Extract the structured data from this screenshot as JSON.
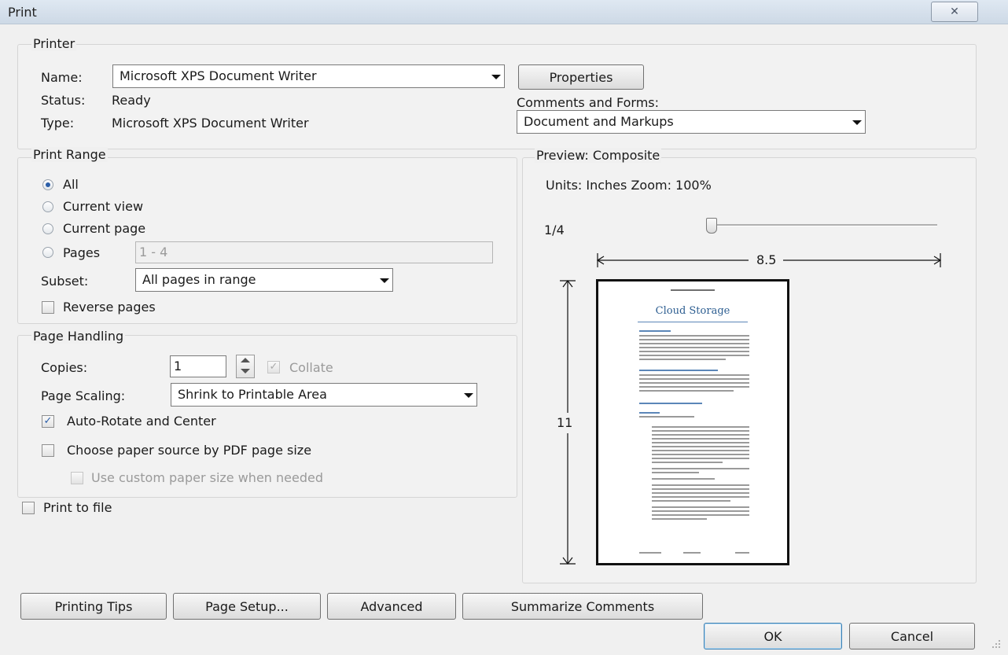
{
  "window": {
    "title": "Print",
    "close_glyph": "✕"
  },
  "printer": {
    "group_title": "Printer",
    "name_label": "Name:",
    "name_value": "Microsoft XPS Document Writer",
    "properties_label": "Properties",
    "status_label": "Status:",
    "status_value": "Ready",
    "type_label": "Type:",
    "type_value": "Microsoft XPS Document Writer",
    "comments_label": "Comments and Forms:",
    "comments_value": "Document and Markups"
  },
  "print_range": {
    "group_title": "Print Range",
    "options": [
      "All",
      "Current view",
      "Current page",
      "Pages"
    ],
    "selected": "All",
    "pages_value": "1 - 4",
    "subset_label": "Subset:",
    "subset_value": "All pages in range",
    "reverse_label": "Reverse pages",
    "reverse_checked": false
  },
  "page_handling": {
    "group_title": "Page Handling",
    "copies_label": "Copies:",
    "copies_value": "1",
    "collate_label": "Collate",
    "collate_checked": true,
    "scaling_label": "Page Scaling:",
    "scaling_value": "Shrink to Printable Area",
    "autorotate_label": "Auto-Rotate and Center",
    "autorotate_checked": true,
    "paper_source_label": "Choose paper source by PDF page size",
    "paper_source_checked": false,
    "custom_paper_label": "Use custom paper size when needed",
    "custom_paper_checked": false
  },
  "print_to_file": {
    "label": "Print to file",
    "checked": false
  },
  "preview": {
    "group_title": "Preview: Composite",
    "units_zoom": "Units: Inches Zoom: 100%",
    "page_indicator": "1/4",
    "width_label": "8.5",
    "height_label": "11",
    "doc_title": "Cloud Storage"
  },
  "buttons": {
    "printing_tips": "Printing Tips",
    "page_setup": "Page Setup...",
    "advanced": "Advanced",
    "summarize": "Summarize Comments",
    "ok": "OK",
    "cancel": "Cancel"
  },
  "colors": {
    "accent": "#2b5ea8",
    "doc_title": "#2d5e91"
  },
  "icons": {
    "close": "close-icon",
    "dropdown": "chevron-down-icon",
    "spin": "spin-arrows-icon",
    "slider": "slider-thumb-icon"
  }
}
